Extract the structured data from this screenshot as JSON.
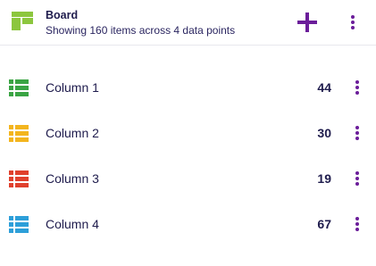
{
  "header": {
    "title": "Board",
    "subtitle": "Showing 160 items across 4 data points",
    "icon": "board-icon",
    "icon_color": "#8cc63e",
    "accent": "#6b1d9a"
  },
  "rows": [
    {
      "label": "Column 1",
      "count": "44",
      "color": "#3aa444",
      "icon": "list-icon"
    },
    {
      "label": "Column 2",
      "count": "30",
      "color": "#f3b51e",
      "icon": "list-icon"
    },
    {
      "label": "Column 3",
      "count": "19",
      "color": "#e0402d",
      "icon": "list-icon"
    },
    {
      "label": "Column 4",
      "count": "67",
      "color": "#2d9fd9",
      "icon": "list-icon"
    }
  ]
}
